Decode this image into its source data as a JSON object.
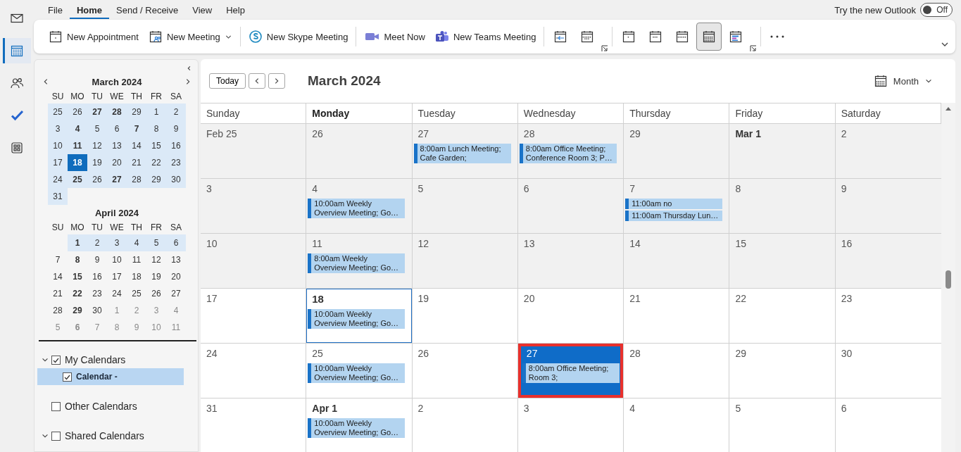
{
  "nav_rail": [
    {
      "selected": false
    },
    {
      "selected": true
    },
    {
      "selected": false
    },
    {
      "selected": false
    },
    {
      "selected": false
    }
  ],
  "menu": [
    {
      "label": "File",
      "selected": false
    },
    {
      "label": "Home",
      "selected": true
    },
    {
      "label": "Send / Receive",
      "selected": false
    },
    {
      "label": "View",
      "selected": false
    },
    {
      "label": "Help",
      "selected": false
    }
  ],
  "new_outlook": {
    "label": "Try the new Outlook",
    "toggle": "Off",
    "on": false
  },
  "ribbon": {
    "groups": [
      {
        "items": [
          {
            "kind": "labeled",
            "label": "New Appointment"
          },
          {
            "kind": "labeled",
            "label": "New Meeting",
            "dropdown": true
          }
        ]
      },
      {
        "items": [
          {
            "kind": "labeled",
            "label": "New Skype Meeting"
          }
        ]
      },
      {
        "items": [
          {
            "kind": "labeled",
            "label": "Meet Now"
          },
          {
            "kind": "labeled",
            "label": "New Teams Meeting"
          }
        ]
      },
      {
        "launcher": true,
        "items": [
          {
            "kind": "icon",
            "selected": false
          },
          {
            "kind": "icon",
            "selected": false
          }
        ]
      },
      {
        "launcher": true,
        "items": [
          {
            "kind": "icon",
            "selected": false
          },
          {
            "kind": "icon",
            "selected": false
          },
          {
            "kind": "icon",
            "selected": false
          },
          {
            "kind": "icon",
            "selected": true
          },
          {
            "kind": "icon",
            "selected": false
          }
        ]
      },
      {
        "items": [
          {
            "kind": "more"
          }
        ]
      }
    ]
  },
  "mini_calendars": [
    {
      "title": "March 2024",
      "weekdays": [
        "SU",
        "MO",
        "TU",
        "WE",
        "TH",
        "FR",
        "SA"
      ],
      "weeks": [
        [
          {
            "day": "25",
            "bold": false,
            "in_view": true,
            "selected": false,
            "muted": false
          },
          {
            "day": "26",
            "bold": false,
            "in_view": true,
            "selected": false,
            "muted": false
          },
          {
            "day": "27",
            "bold": true,
            "in_view": true,
            "selected": false,
            "muted": false
          },
          {
            "day": "28",
            "bold": true,
            "in_view": true,
            "selected": false,
            "muted": false
          },
          {
            "day": "29",
            "bold": false,
            "in_view": true,
            "selected": false,
            "muted": false
          },
          {
            "day": "1",
            "bold": false,
            "in_view": true,
            "selected": false,
            "muted": false
          },
          {
            "day": "2",
            "bold": false,
            "in_view": true,
            "selected": false,
            "muted": false
          }
        ],
        [
          {
            "day": "3",
            "bold": false,
            "in_view": true,
            "selected": false,
            "muted": false
          },
          {
            "day": "4",
            "bold": true,
            "in_view": true,
            "selected": false,
            "muted": false
          },
          {
            "day": "5",
            "bold": false,
            "in_view": true,
            "selected": false,
            "muted": false
          },
          {
            "day": "6",
            "bold": false,
            "in_view": true,
            "selected": false,
            "muted": false
          },
          {
            "day": "7",
            "bold": true,
            "in_view": true,
            "selected": false,
            "muted": false
          },
          {
            "day": "8",
            "bold": false,
            "in_view": true,
            "selected": false,
            "muted": false
          },
          {
            "day": "9",
            "bold": false,
            "in_view": true,
            "selected": false,
            "muted": false
          }
        ],
        [
          {
            "day": "10",
            "bold": false,
            "in_view": true,
            "selected": false,
            "muted": false
          },
          {
            "day": "11",
            "bold": true,
            "in_view": true,
            "selected": false,
            "muted": false
          },
          {
            "day": "12",
            "bold": false,
            "in_view": true,
            "selected": false,
            "muted": false
          },
          {
            "day": "13",
            "bold": false,
            "in_view": true,
            "selected": false,
            "muted": false
          },
          {
            "day": "14",
            "bold": false,
            "in_view": true,
            "selected": false,
            "muted": false
          },
          {
            "day": "15",
            "bold": false,
            "in_view": true,
            "selected": false,
            "muted": false
          },
          {
            "day": "16",
            "bold": false,
            "in_view": true,
            "selected": false,
            "muted": false
          }
        ],
        [
          {
            "day": "17",
            "bold": false,
            "in_view": true,
            "selected": false,
            "muted": false
          },
          {
            "day": "18",
            "bold": true,
            "in_view": true,
            "selected": true,
            "muted": false
          },
          {
            "day": "19",
            "bold": false,
            "in_view": true,
            "selected": false,
            "muted": false
          },
          {
            "day": "20",
            "bold": false,
            "in_view": true,
            "selected": false,
            "muted": false
          },
          {
            "day": "21",
            "bold": false,
            "in_view": true,
            "selected": false,
            "muted": false
          },
          {
            "day": "22",
            "bold": false,
            "in_view": true,
            "selected": false,
            "muted": false
          },
          {
            "day": "23",
            "bold": false,
            "in_view": true,
            "selected": false,
            "muted": false
          }
        ],
        [
          {
            "day": "24",
            "bold": false,
            "in_view": true,
            "selected": false,
            "muted": false
          },
          {
            "day": "25",
            "bold": true,
            "in_view": true,
            "selected": false,
            "muted": false
          },
          {
            "day": "26",
            "bold": false,
            "in_view": true,
            "selected": false,
            "muted": false
          },
          {
            "day": "27",
            "bold": true,
            "in_view": true,
            "selected": false,
            "muted": false
          },
          {
            "day": "28",
            "bold": false,
            "in_view": true,
            "selected": false,
            "muted": false
          },
          {
            "day": "29",
            "bold": false,
            "in_view": true,
            "selected": false,
            "muted": false
          },
          {
            "day": "30",
            "bold": false,
            "in_view": true,
            "selected": false,
            "muted": false
          }
        ],
        [
          {
            "day": "31",
            "bold": false,
            "in_view": true,
            "selected": false,
            "muted": false
          }
        ]
      ]
    },
    {
      "title": "April 2024",
      "weekdays": [
        "SU",
        "MO",
        "TU",
        "WE",
        "TH",
        "FR",
        "SA"
      ],
      "weeks": [
        [
          {
            "day": "1",
            "bold": true,
            "in_view": true,
            "selected": false,
            "muted": false
          },
          {
            "day": "2",
            "bold": false,
            "in_view": true,
            "selected": false,
            "muted": false
          },
          {
            "day": "3",
            "bold": false,
            "in_view": true,
            "selected": false,
            "muted": false
          },
          {
            "day": "4",
            "bold": false,
            "in_view": true,
            "selected": false,
            "muted": false
          },
          {
            "day": "5",
            "bold": false,
            "in_view": true,
            "selected": false,
            "muted": false
          },
          {
            "day": "6",
            "bold": false,
            "in_view": true,
            "selected": false,
            "muted": false
          }
        ],
        [
          {
            "day": "7",
            "bold": false,
            "in_view": false,
            "selected": false,
            "muted": false
          },
          {
            "day": "8",
            "bold": true,
            "in_view": false,
            "selected": false,
            "muted": false
          },
          {
            "day": "9",
            "bold": false,
            "in_view": false,
            "selected": false,
            "muted": false
          },
          {
            "day": "10",
            "bold": false,
            "in_view": false,
            "selected": false,
            "muted": false
          },
          {
            "day": "11",
            "bold": false,
            "in_view": false,
            "selected": false,
            "muted": false
          },
          {
            "day": "12",
            "bold": false,
            "in_view": false,
            "selected": false,
            "muted": false
          },
          {
            "day": "13",
            "bold": false,
            "in_view": false,
            "selected": false,
            "muted": false
          }
        ],
        [
          {
            "day": "14",
            "bold": false,
            "in_view": false,
            "selected": false,
            "muted": false
          },
          {
            "day": "15",
            "bold": true,
            "in_view": false,
            "selected": false,
            "muted": false
          },
          {
            "day": "16",
            "bold": false,
            "in_view": false,
            "selected": false,
            "muted": false
          },
          {
            "day": "17",
            "bold": false,
            "in_view": false,
            "selected": false,
            "muted": false
          },
          {
            "day": "18",
            "bold": false,
            "in_view": false,
            "selected": false,
            "muted": false
          },
          {
            "day": "19",
            "bold": false,
            "in_view": false,
            "selected": false,
            "muted": false
          },
          {
            "day": "20",
            "bold": false,
            "in_view": false,
            "selected": false,
            "muted": false
          }
        ],
        [
          {
            "day": "21",
            "bold": false,
            "in_view": false,
            "selected": false,
            "muted": false
          },
          {
            "day": "22",
            "bold": true,
            "in_view": false,
            "selected": false,
            "muted": false
          },
          {
            "day": "23",
            "bold": false,
            "in_view": false,
            "selected": false,
            "muted": false
          },
          {
            "day": "24",
            "bold": false,
            "in_view": false,
            "selected": false,
            "muted": false
          },
          {
            "day": "25",
            "bold": false,
            "in_view": false,
            "selected": false,
            "muted": false
          },
          {
            "day": "26",
            "bold": false,
            "in_view": false,
            "selected": false,
            "muted": false
          },
          {
            "day": "27",
            "bold": false,
            "in_view": false,
            "selected": false,
            "muted": false
          }
        ],
        [
          {
            "day": "28",
            "bold": false,
            "in_view": false,
            "selected": false,
            "muted": false
          },
          {
            "day": "29",
            "bold": true,
            "in_view": false,
            "selected": false,
            "muted": false
          },
          {
            "day": "30",
            "bold": false,
            "in_view": false,
            "selected": false,
            "muted": false
          },
          {
            "day": "1",
            "bold": false,
            "in_view": false,
            "selected": false,
            "muted": true
          },
          {
            "day": "2",
            "bold": false,
            "in_view": false,
            "selected": false,
            "muted": true
          },
          {
            "day": "3",
            "bold": false,
            "in_view": false,
            "selected": false,
            "muted": true
          },
          {
            "day": "4",
            "bold": false,
            "in_view": false,
            "selected": false,
            "muted": true
          }
        ],
        [
          {
            "day": "5",
            "bold": false,
            "in_view": false,
            "selected": false,
            "muted": true
          },
          {
            "day": "6",
            "bold": true,
            "in_view": false,
            "selected": false,
            "muted": true
          },
          {
            "day": "7",
            "bold": false,
            "in_view": false,
            "selected": false,
            "muted": true
          },
          {
            "day": "8",
            "bold": false,
            "in_view": false,
            "selected": false,
            "muted": true
          },
          {
            "day": "9",
            "bold": false,
            "in_view": false,
            "selected": false,
            "muted": true
          },
          {
            "day": "10",
            "bold": false,
            "in_view": false,
            "selected": false,
            "muted": true
          },
          {
            "day": "11",
            "bold": false,
            "in_view": false,
            "selected": false,
            "muted": true
          }
        ]
      ]
    }
  ],
  "calendar_tree": [
    {
      "label": "My Calendars",
      "checked": true,
      "expanded": true,
      "selected": false,
      "children": [
        {
          "label": "Calendar -",
          "checked": true,
          "selected": true
        }
      ]
    },
    {
      "label": "Other Calendars",
      "checked": false,
      "selected": false
    },
    {
      "label": "Shared Calendars",
      "checked": false,
      "expanded": true,
      "selected": false
    }
  ],
  "month_view": {
    "today_button": "Today",
    "title": "March 2024",
    "view": "Month",
    "weekdays": [
      {
        "label": "Sunday",
        "current": false
      },
      {
        "label": "Monday",
        "current": true
      },
      {
        "label": "Tuesday",
        "current": false
      },
      {
        "label": "Wednesday",
        "current": false
      },
      {
        "label": "Thursday",
        "current": false
      },
      {
        "label": "Friday",
        "current": false
      },
      {
        "label": "Saturday",
        "current": false
      }
    ],
    "weeks": [
      [
        {
          "date": "Feb 25",
          "bold": false,
          "past": true,
          "today": false,
          "selected": false,
          "outlined": false
        },
        {
          "date": "26",
          "bold": false,
          "past": true,
          "today": false,
          "selected": false,
          "outlined": false
        },
        {
          "date": "27",
          "bold": false,
          "past": true,
          "today": false,
          "selected": false,
          "outlined": false,
          "events": [
            {
              "lines": [
                "8:00am Lunch Meeting;",
                "Cafe Garden;"
              ]
            }
          ]
        },
        {
          "date": "28",
          "bold": false,
          "past": true,
          "today": false,
          "selected": false,
          "outlined": false,
          "events": [
            {
              "lines": [
                "8:00am Office Meeting;",
                "Conference Room 3; P…"
              ]
            }
          ]
        },
        {
          "date": "29",
          "bold": false,
          "past": true,
          "today": false,
          "selected": false,
          "outlined": false
        },
        {
          "date": "Mar 1",
          "bold": true,
          "past": true,
          "today": false,
          "selected": false,
          "outlined": false
        },
        {
          "date": "2",
          "bold": false,
          "past": true,
          "today": false,
          "selected": false,
          "outlined": false
        }
      ],
      [
        {
          "date": "3",
          "bold": false,
          "past": true,
          "today": false,
          "selected": false,
          "outlined": false
        },
        {
          "date": "4",
          "bold": false,
          "past": true,
          "today": false,
          "selected": false,
          "outlined": false,
          "events": [
            {
              "lines": [
                "10:00am Weekly",
                "Overview Meeting; Go…"
              ]
            }
          ]
        },
        {
          "date": "5",
          "bold": false,
          "past": true,
          "today": false,
          "selected": false,
          "outlined": false
        },
        {
          "date": "6",
          "bold": false,
          "past": true,
          "today": false,
          "selected": false,
          "outlined": false
        },
        {
          "date": "7",
          "bold": false,
          "past": true,
          "today": false,
          "selected": false,
          "outlined": false,
          "events": [
            {
              "lines": [
                "11:00am no"
              ]
            },
            {
              "lines": [
                "11:00am Thursday Lun…"
              ]
            }
          ]
        },
        {
          "date": "8",
          "bold": false,
          "past": true,
          "today": false,
          "selected": false,
          "outlined": false
        },
        {
          "date": "9",
          "bold": false,
          "past": true,
          "today": false,
          "selected": false,
          "outlined": false
        }
      ],
      [
        {
          "date": "10",
          "bold": false,
          "past": true,
          "today": false,
          "selected": false,
          "outlined": false
        },
        {
          "date": "11",
          "bold": false,
          "past": true,
          "today": false,
          "selected": false,
          "outlined": false,
          "events": [
            {
              "lines": [
                "8:00am Weekly",
                "Overview Meeting; Go…"
              ]
            }
          ]
        },
        {
          "date": "12",
          "bold": false,
          "past": true,
          "today": false,
          "selected": false,
          "outlined": false
        },
        {
          "date": "13",
          "bold": false,
          "past": true,
          "today": false,
          "selected": false,
          "outlined": false
        },
        {
          "date": "14",
          "bold": false,
          "past": true,
          "today": false,
          "selected": false,
          "outlined": false
        },
        {
          "date": "15",
          "bold": false,
          "past": true,
          "today": false,
          "selected": false,
          "outlined": false
        },
        {
          "date": "16",
          "bold": false,
          "past": true,
          "today": false,
          "selected": false,
          "outlined": false
        }
      ],
      [
        {
          "date": "17",
          "bold": false,
          "past": false,
          "today": false,
          "selected": false,
          "outlined": false
        },
        {
          "date": "18",
          "bold": true,
          "past": false,
          "today": true,
          "selected": false,
          "outlined": false,
          "events": [
            {
              "lines": [
                "10:00am Weekly",
                "Overview Meeting; Go…"
              ]
            }
          ]
        },
        {
          "date": "19",
          "bold": false,
          "past": false,
          "today": false,
          "selected": false,
          "outlined": false
        },
        {
          "date": "20",
          "bold": false,
          "past": false,
          "today": false,
          "selected": false,
          "outlined": false
        },
        {
          "date": "21",
          "bold": false,
          "past": false,
          "today": false,
          "selected": false,
          "outlined": false
        },
        {
          "date": "22",
          "bold": false,
          "past": false,
          "today": false,
          "selected": false,
          "outlined": false
        },
        {
          "date": "23",
          "bold": false,
          "past": false,
          "today": false,
          "selected": false,
          "outlined": false
        }
      ],
      [
        {
          "date": "24",
          "bold": false,
          "past": false,
          "today": false,
          "selected": false,
          "outlined": false
        },
        {
          "date": "25",
          "bold": false,
          "past": false,
          "today": false,
          "selected": false,
          "outlined": false,
          "events": [
            {
              "lines": [
                "10:00am Weekly",
                "Overview Meeting; Go…"
              ]
            }
          ]
        },
        {
          "date": "26",
          "bold": false,
          "past": false,
          "today": false,
          "selected": false,
          "outlined": false
        },
        {
          "date": "27",
          "bold": false,
          "past": false,
          "today": false,
          "selected": true,
          "outlined": true,
          "events": [
            {
              "lines": [
                "8:00am Office Meeting;",
                "Room 3;"
              ]
            }
          ]
        },
        {
          "date": "28",
          "bold": false,
          "past": false,
          "today": false,
          "selected": false,
          "outlined": false
        },
        {
          "date": "29",
          "bold": false,
          "past": false,
          "today": false,
          "selected": false,
          "outlined": false
        },
        {
          "date": "30",
          "bold": false,
          "past": false,
          "today": false,
          "selected": false,
          "outlined": false
        }
      ],
      [
        {
          "date": "31",
          "bold": false,
          "past": false,
          "today": false,
          "selected": false,
          "outlined": false
        },
        {
          "date": "Apr 1",
          "bold": true,
          "past": false,
          "today": false,
          "selected": false,
          "outlined": false,
          "events": [
            {
              "lines": [
                "10:00am Weekly",
                "Overview Meeting; Go…"
              ]
            }
          ]
        },
        {
          "date": "2",
          "bold": false,
          "past": false,
          "today": false,
          "selected": false,
          "outlined": false
        },
        {
          "date": "3",
          "bold": false,
          "past": false,
          "today": false,
          "selected": false,
          "outlined": false
        },
        {
          "date": "4",
          "bold": false,
          "past": false,
          "today": false,
          "selected": false,
          "outlined": false
        },
        {
          "date": "5",
          "bold": false,
          "past": false,
          "today": false,
          "selected": false,
          "outlined": false
        },
        {
          "date": "6",
          "bold": false,
          "past": false,
          "today": false,
          "selected": false,
          "outlined": false
        }
      ]
    ]
  }
}
